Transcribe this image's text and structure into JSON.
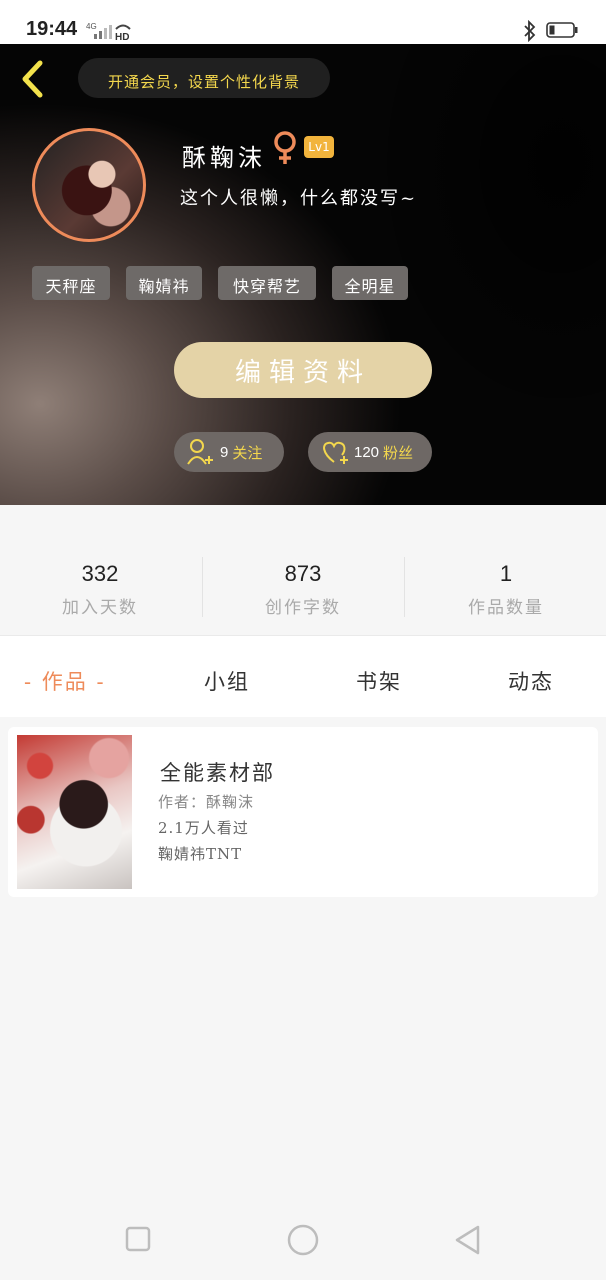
{
  "status_bar": {
    "time": "19:44",
    "network": "4G",
    "hd": "HD"
  },
  "header": {
    "vip_prompt": "开通会员，设置个性化背景",
    "username": "酥鞠沫",
    "level": "Lv1",
    "bio": "这个人很懒，什么都没写~",
    "tags": [
      "天秤座",
      "鞠婧祎",
      "快穿帮艺",
      "全明星"
    ],
    "edit_label": "编辑资料",
    "following": {
      "count": "9",
      "label": "关注"
    },
    "fans": {
      "count": "120",
      "label": "粉丝"
    }
  },
  "stats": [
    {
      "value": "332",
      "label": "加入天数"
    },
    {
      "value": "873",
      "label": "创作字数"
    },
    {
      "value": "1",
      "label": "作品数量"
    }
  ],
  "tabs": [
    "- 作品 -",
    "小组",
    "书架",
    "动态"
  ],
  "works": [
    {
      "title": "全能素材部",
      "author": "作者：酥鞠沫",
      "views": "2.1万人看过",
      "tag": "鞠婧祎TNT"
    }
  ],
  "colors": {
    "accent": "#ee8b5a",
    "vip_text": "#f3d74d",
    "edit_button": "#e4d3a7",
    "level_badge": "#f2b43c"
  },
  "icons": {
    "back": "chevron-left-icon",
    "gender": "female-icon",
    "follow": "add-user-icon",
    "fans": "heart-plus-icon"
  }
}
